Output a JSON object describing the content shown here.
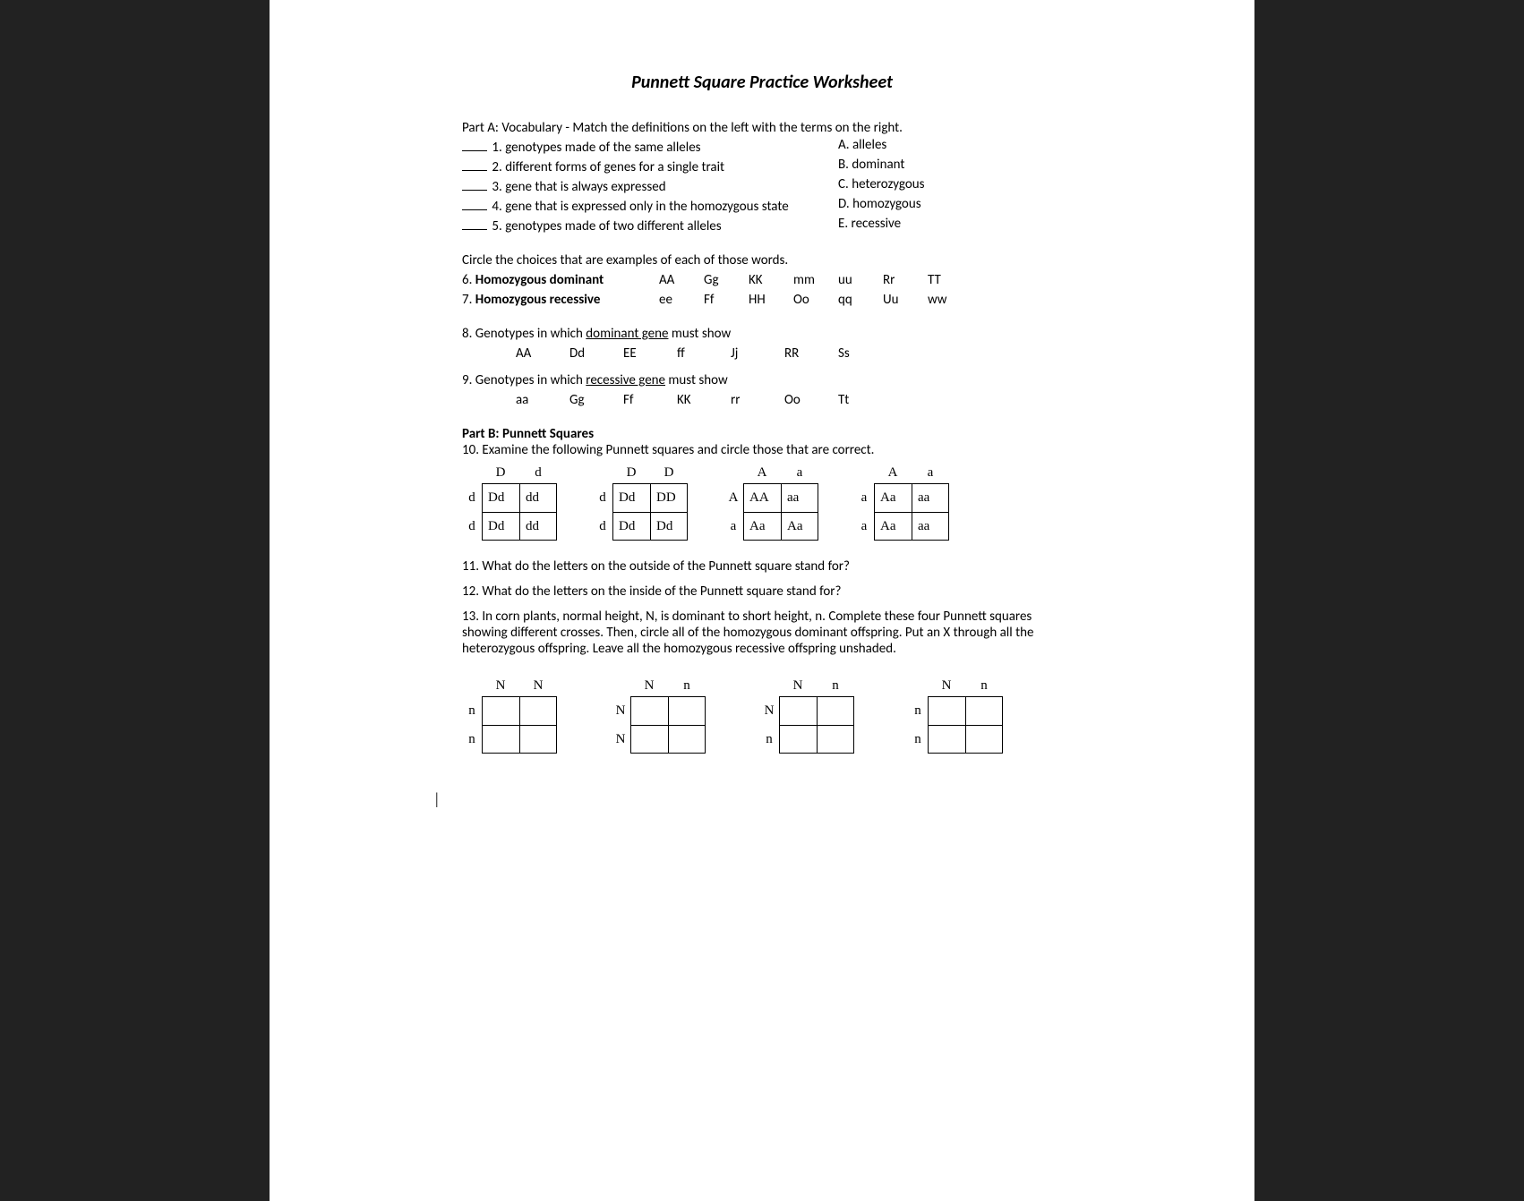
{
  "title": "Punnett Square Practice Worksheet",
  "partA": {
    "heading": "Part A: Vocabulary - Match the definitions on the left with the terms on the right.",
    "items": [
      {
        "num": "1.",
        "def": "genotypes made of the same alleles",
        "letter": "A.",
        "term": "alleles"
      },
      {
        "num": "2.",
        "def": "different forms of genes for a single trait",
        "letter": "B.",
        "term": "dominant"
      },
      {
        "num": "3.",
        "def": "gene that is always expressed",
        "letter": "C.",
        "term": "heterozygous"
      },
      {
        "num": "4.",
        "def": "gene that is expressed only in the homozygous state",
        "letter": "D.",
        "term": "homozygous"
      },
      {
        "num": "5.",
        "def": "genotypes made of two different alleles",
        "letter": "E.",
        "term": "recessive"
      }
    ],
    "circleIntro": "Circle the choices that are examples of each of those words.",
    "q6": {
      "label": "6. ",
      "bold": "Homozygous dominant",
      "opts": [
        "AA",
        "Gg",
        "KK",
        "mm",
        "uu",
        "Rr",
        "TT"
      ]
    },
    "q7": {
      "label": "7. ",
      "bold": "Homozygous recessive",
      "opts": [
        "ee",
        "Ff",
        "HH",
        "Oo",
        "qq",
        "Uu",
        "ww"
      ]
    },
    "q8": {
      "pre": "8. Genotypes in which ",
      "und": "dominant gene",
      "post": " must show",
      "opts": [
        "AA",
        "Dd",
        "EE",
        "ff",
        "Jj",
        "RR",
        "Ss"
      ]
    },
    "q9": {
      "pre": "9. Genotypes in which ",
      "und": "recessive gene",
      "post": " must show",
      "opts": [
        "aa",
        "Gg",
        "Ff",
        "KK",
        "rr",
        "Oo",
        "Tt"
      ]
    }
  },
  "partB": {
    "heading": "Part B: Punnett Squares",
    "q10": "10. Examine the following Punnett squares and circle those that are correct.",
    "squares10": [
      {
        "top": [
          "D",
          "d"
        ],
        "side": [
          "d",
          "d"
        ],
        "cells": [
          "Dd",
          "dd",
          "Dd",
          "dd"
        ]
      },
      {
        "top": [
          "D",
          "D"
        ],
        "side": [
          "d",
          "d"
        ],
        "cells": [
          "Dd",
          "DD",
          "Dd",
          "Dd"
        ]
      },
      {
        "top": [
          "A",
          "a"
        ],
        "side": [
          "A",
          "a"
        ],
        "cells": [
          "AA",
          "aa",
          "Aa",
          "Aa"
        ]
      },
      {
        "top": [
          "A",
          "a"
        ],
        "side": [
          "a",
          "a"
        ],
        "cells": [
          "Aa",
          "aa",
          "Aa",
          "aa"
        ]
      }
    ],
    "q11": "11. What do the letters on the outside of the Punnett square stand for?",
    "q12": "12. What do the letters on the inside of the Punnett square stand for?",
    "q13": "13. In corn plants, normal height, N, is dominant to short height, n. Complete these four Punnett squares showing different crosses. Then, circle all of the homozygous dominant offspring. Put an X through all the heterozygous offspring. Leave all the homozygous recessive offspring unshaded.",
    "squares13": [
      {
        "top": [
          "N",
          "N"
        ],
        "side": [
          "n",
          "n"
        ]
      },
      {
        "top": [
          "N",
          "n"
        ],
        "side": [
          "N",
          "N"
        ]
      },
      {
        "top": [
          "N",
          "n"
        ],
        "side": [
          "N",
          "n"
        ]
      },
      {
        "top": [
          "N",
          "n"
        ],
        "side": [
          "n",
          "n"
        ]
      }
    ]
  },
  "cursor": "|"
}
